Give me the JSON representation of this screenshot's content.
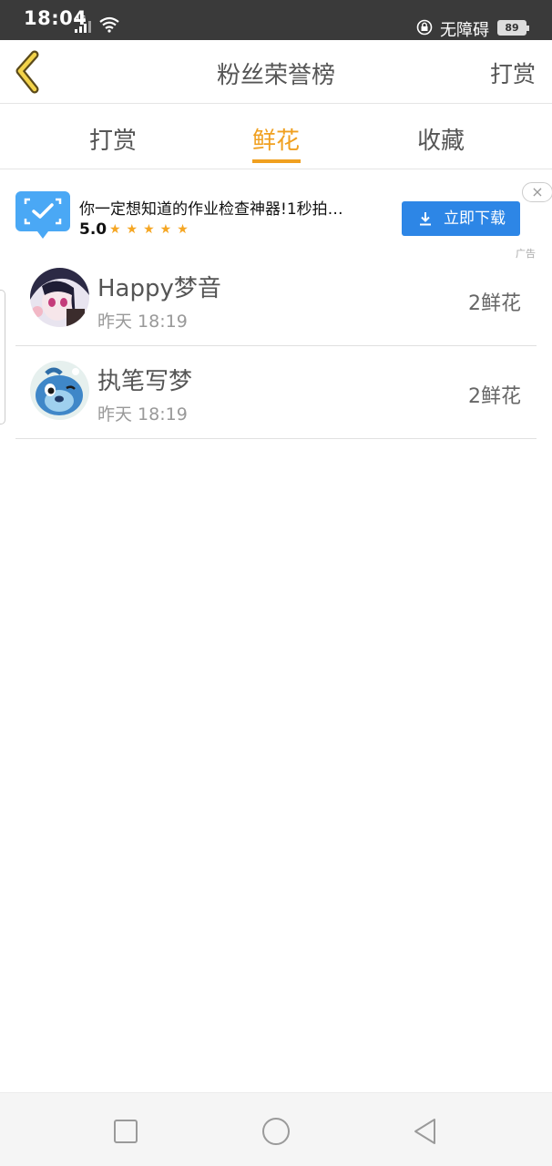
{
  "status_bar": {
    "time": "18:04",
    "network": "4G",
    "accessibility": "无障碍",
    "battery": "89"
  },
  "nav": {
    "title": "粉丝荣誉榜",
    "action": "打赏",
    "back_icon": "chevron-left-icon"
  },
  "tabs": [
    {
      "label": "打赏",
      "active": false
    },
    {
      "label": "鲜花",
      "active": true
    },
    {
      "label": "收藏",
      "active": false
    }
  ],
  "ad": {
    "text": "你一定想知道的作业检查神器!1秒拍…",
    "rating": "5.0",
    "stars": "★★★★★",
    "download_label": "立即下载",
    "close_symbol": "×",
    "label": "广告"
  },
  "list": [
    {
      "name": "Happy梦音",
      "time": "昨天 18:19",
      "count": "2鲜花"
    },
    {
      "name": "执笔写梦",
      "time": "昨天 18:19",
      "count": "2鲜花"
    }
  ],
  "colors": {
    "accent": "#f0a020",
    "download_button": "#2d86e6",
    "status_bar": "#3a3a3a"
  }
}
